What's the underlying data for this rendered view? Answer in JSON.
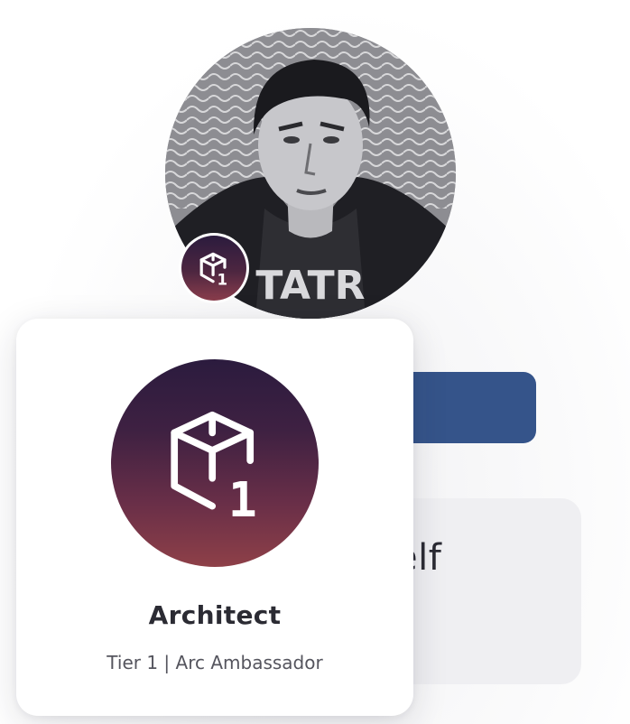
{
  "profile": {
    "avatar_icon": "profile-photo",
    "badge_icon": "cube-tier-1-icon"
  },
  "background": {
    "button_color": "#35548a",
    "card_text": "elf"
  },
  "popup": {
    "icon": "cube-tier-1-icon",
    "icon_gradient": [
      "#2b1b3e",
      "#8e4048"
    ],
    "title": "Architect",
    "subtitle": "Tier 1 | Arc Ambassador"
  }
}
